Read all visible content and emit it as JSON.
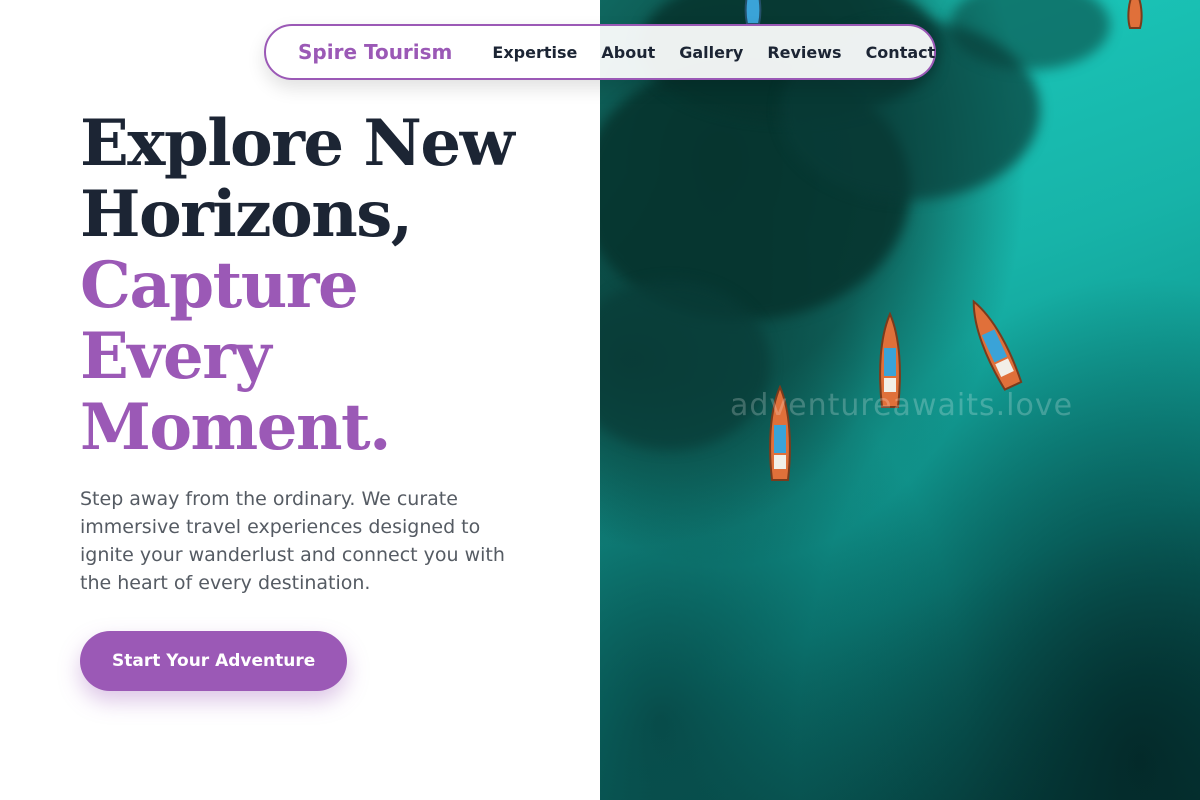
{
  "nav": {
    "brand": "Spire Tourism",
    "links": [
      "Expertise",
      "About",
      "Gallery",
      "Reviews",
      "Contact"
    ]
  },
  "hero": {
    "headline_dark": [
      "Explore New",
      "Horizons,"
    ],
    "headline_accent": [
      "Capture",
      "Every",
      "Moment."
    ],
    "lead": "Step away from the ordinary. We curate immersive travel experiences designed to ignite your wanderlust and connect you with the heart of every destination.",
    "cta_label": "Start Your Adventure"
  },
  "image": {
    "watermark": "adventureawaits.love",
    "alt_subject": "aerial-ocean-boats"
  },
  "colors": {
    "accent": "#9b59b6",
    "headline_dark": "#1c2534",
    "body_text": "#555b63",
    "water": "#17b3a8"
  }
}
